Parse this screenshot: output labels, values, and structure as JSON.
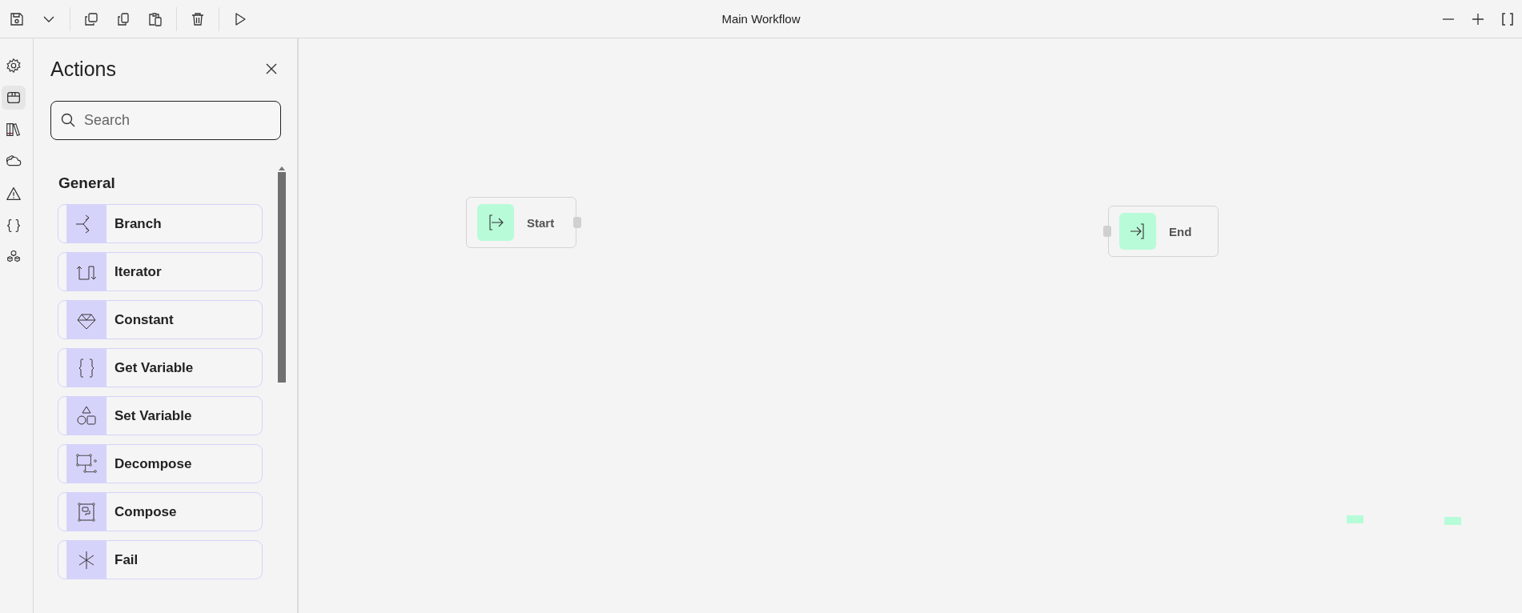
{
  "window": {
    "title": "Main Workflow"
  },
  "rail": [
    {
      "kind": "settings",
      "selected": false
    },
    {
      "kind": "box",
      "selected": true
    },
    {
      "kind": "library",
      "selected": false
    },
    {
      "kind": "cloud",
      "selected": false
    },
    {
      "kind": "warning",
      "selected": false
    },
    {
      "kind": "braces",
      "selected": false
    },
    {
      "kind": "blocks",
      "selected": false
    }
  ],
  "panel": {
    "title": "Actions",
    "search": {
      "placeholder": "Search"
    },
    "sections": [
      {
        "heading": "General",
        "items": [
          {
            "label": "Branch",
            "kind": "branch"
          },
          {
            "label": "Iterator",
            "kind": "iterator"
          },
          {
            "label": "Constant",
            "kind": "constant"
          },
          {
            "label": "Get Variable",
            "kind": "get"
          },
          {
            "label": "Set Variable",
            "kind": "set"
          },
          {
            "label": "Decompose",
            "kind": "decompose"
          },
          {
            "label": "Compose",
            "kind": "compose"
          },
          {
            "label": "Fail",
            "kind": "fail"
          }
        ]
      }
    ]
  },
  "canvas": {
    "nodes": [
      {
        "label": "Start",
        "kind": "start"
      },
      {
        "label": "End",
        "kind": "end"
      }
    ]
  }
}
